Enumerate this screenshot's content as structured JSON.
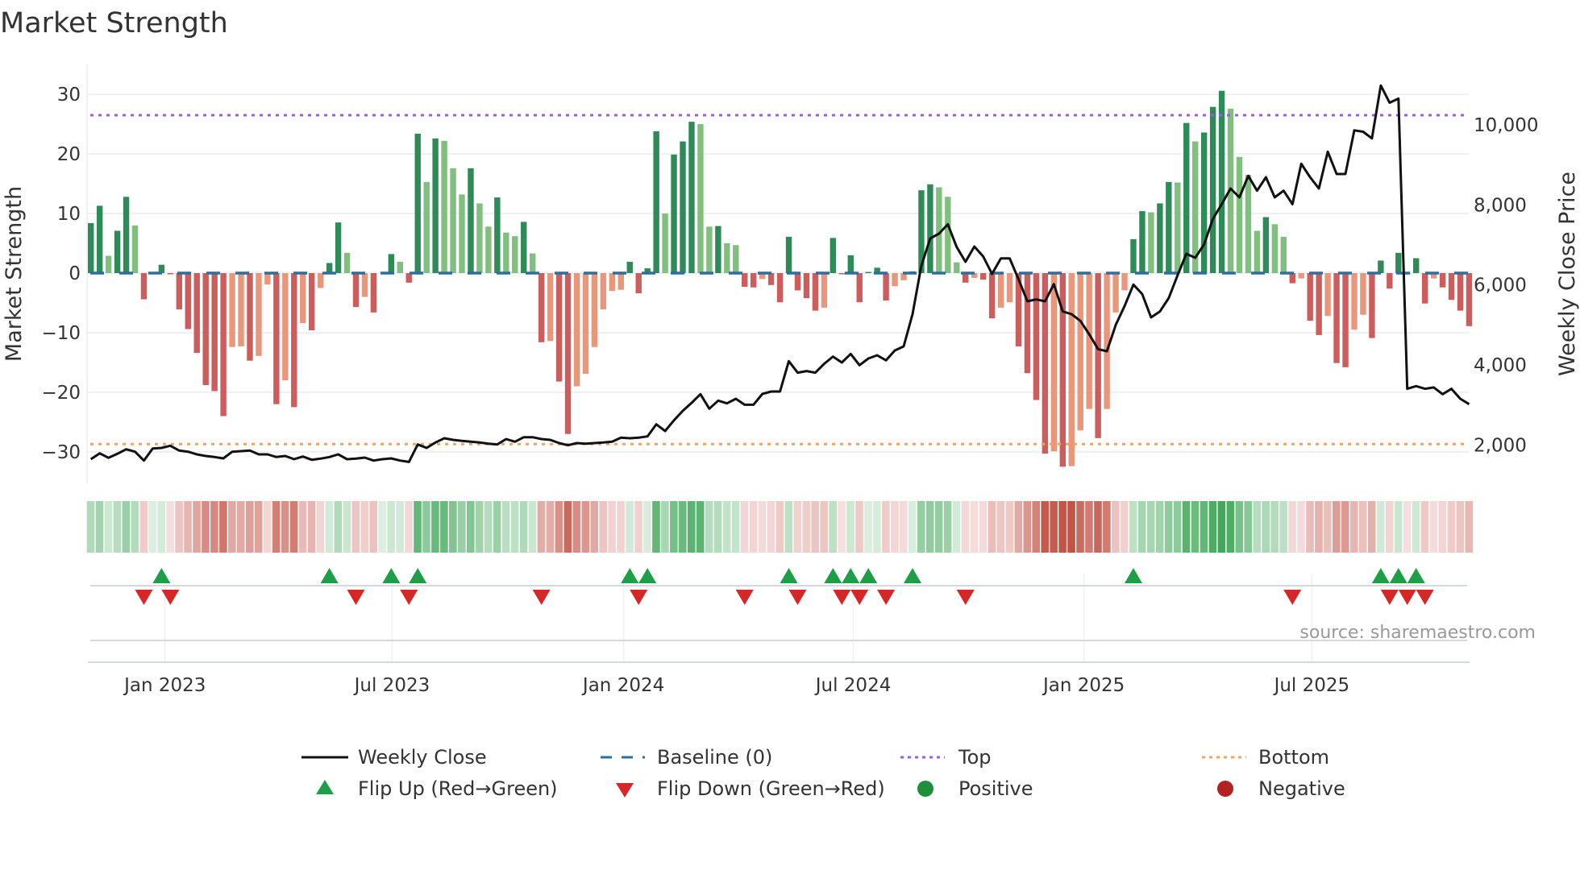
{
  "chart_data": {
    "type": "bar",
    "title": "Market Strength",
    "ylabel": "Market Strength",
    "y2label": "Weekly Close Price",
    "ylim": [
      -35,
      35
    ],
    "y2lim": [
      1000,
      11500
    ],
    "grid": true,
    "yticks": [
      "30",
      "20",
      "10",
      "0",
      "−10",
      "−20",
      "−30"
    ],
    "ytick_values": [
      30,
      20,
      10,
      0,
      -10,
      -20,
      -30
    ],
    "y2ticks": [
      "2,000",
      "4,000",
      "6,000",
      "8,000",
      "10,000"
    ],
    "y2tick_values": [
      2000,
      4000,
      6000,
      8000,
      10000
    ],
    "xticks": [
      "Jan 2023",
      "Jul 2023",
      "Jan 2024",
      "Jul 2024",
      "Jan 2025",
      "Jul 2025"
    ],
    "top_level": 26.5,
    "bottom_level": -28.7,
    "strength": [
      8.4,
      11.3,
      2.9,
      7.1,
      12.8,
      8.0,
      -4.4,
      0,
      1.4,
      -0.2,
      -6.1,
      -9.4,
      -13.4,
      -18.8,
      -19.8,
      -24.0,
      -12.4,
      -12.3,
      -14.7,
      -13.9,
      -1.9,
      -22.0,
      -18.0,
      -22.5,
      -8.4,
      -9.6,
      -2.5,
      1.7,
      8.5,
      3.4,
      -5.7,
      -4.0,
      -6.6,
      0,
      3.2,
      1.9,
      -1.6,
      23.4,
      15.3,
      22.6,
      22.2,
      17.6,
      13.2,
      17.6,
      11.7,
      7.8,
      12.7,
      6.8,
      6.2,
      8.6,
      3.3,
      -11.6,
      -11.4,
      -18.2,
      -27.0,
      -19.0,
      -16.9,
      -12.4,
      -6.1,
      -3.0,
      -2.8,
      1.9,
      -3.4,
      0.8,
      23.8,
      10.0,
      19.9,
      22.1,
      25.4,
      25.0,
      7.8,
      7.9,
      5.0,
      4.7,
      -2.3,
      -2.4,
      -1.0,
      -2.0,
      -4.9,
      6.1,
      -2.9,
      -4.2,
      -6.3,
      -5.8,
      5.9,
      -0.1,
      3.0,
      -4.9,
      0.2,
      0.9,
      -4.6,
      -2.2,
      -1.2,
      0.3,
      13.9,
      14.9,
      14.4,
      12.8,
      1.8,
      -1.6,
      -0.8,
      -1.1,
      -7.6,
      -5.8,
      -4.9,
      -12.3,
      -16.8,
      -21.3,
      -30.3,
      -29.9,
      -32.5,
      -32.4,
      -26.4,
      -22.8,
      -27.7,
      -22.8,
      -6.6,
      -2.9,
      5.7,
      10.4,
      10.2,
      11.7,
      15.3,
      15.2,
      25.2,
      22.1,
      23.6,
      27.9,
      30.6,
      27.6,
      19.5,
      16.5,
      7.1,
      9.4,
      8.2,
      6.1,
      -1.7,
      -0.9,
      -8.0,
      -10.4,
      -7.2,
      -15.1,
      -15.8,
      -9.5,
      -7.0,
      -10.9,
      2.1,
      -2.6,
      3.4,
      -0.2,
      2.5,
      -5.1,
      -0.9,
      -2.4,
      -4.5,
      -6.3,
      -8.9
    ],
    "weekly_close": [
      1648,
      1795,
      1682,
      1782,
      1896,
      1835,
      1614,
      1916,
      1930,
      1984,
      1863,
      1835,
      1769,
      1728,
      1702,
      1668,
      1835,
      1849,
      1863,
      1769,
      1769,
      1702,
      1728,
      1648,
      1715,
      1634,
      1661,
      1702,
      1769,
      1648,
      1661,
      1688,
      1614,
      1648,
      1668,
      1614,
      1580,
      2017,
      1930,
      2064,
      2171,
      2131,
      2104,
      2084,
      2064,
      2037,
      2017,
      2151,
      2084,
      2198,
      2198,
      2151,
      2131,
      2050,
      1996,
      2050,
      2037,
      2050,
      2064,
      2084,
      2185,
      2171,
      2185,
      2218,
      2519,
      2352,
      2620,
      2855,
      3056,
      3271,
      2909,
      3111,
      3042,
      3157,
      3009,
      3009,
      3278,
      3338,
      3338,
      4097,
      3809,
      3850,
      3809,
      4030,
      4211,
      4063,
      4278,
      3996,
      4163,
      4244,
      4117,
      4365,
      4465,
      5270,
      6477,
      7161,
      7282,
      7517,
      6946,
      6578,
      6960,
      6712,
      6276,
      6665,
      6665,
      6142,
      5592,
      5638,
      5592,
      6021,
      5338,
      5270,
      5103,
      4767,
      4398,
      4344,
      5002,
      5471,
      6008,
      5773,
      5190,
      5338,
      5672,
      6243,
      6780,
      6679,
      7015,
      7651,
      8020,
      8409,
      8188,
      8725,
      8355,
      8692,
      8188,
      8355,
      8020,
      9027,
      8692,
      8409,
      9329,
      8772,
      8772,
      9862,
      9829,
      9661,
      10984,
      10554,
      10655,
      3406,
      3473,
      3406,
      3440,
      3272,
      3406,
      3157,
      3022
    ],
    "legend": {
      "placement": "bottom",
      "items": [
        {
          "label": "Weekly Close",
          "symbol": "line"
        },
        {
          "label": "Baseline (0)",
          "symbol": "dashed"
        },
        {
          "label": "Top",
          "symbol": "dotted"
        },
        {
          "label": "Bottom",
          "symbol": "dotted"
        },
        {
          "label": "Flip Up (Red→Green)",
          "symbol": "triangle-up"
        },
        {
          "label": "Flip Down (Green→Red)",
          "symbol": "triangle-down"
        },
        {
          "label": "Positive",
          "symbol": "circle"
        },
        {
          "label": "Negative",
          "symbol": "circle"
        }
      ]
    },
    "source": "source: sharemaestro.com"
  },
  "colors": {
    "pos_rising": "#2e8b57",
    "pos_falling": "#80bf7d",
    "neg_falling": "#cd5c5c",
    "neg_rising": "#e9967a",
    "price_line": "#111111",
    "baseline": "#2a6f9e",
    "top": "#9b5de5",
    "bottom": "#f4a460",
    "flip_up": "#1e9e48",
    "flip_down": "#d62728",
    "positive": "#1e8f3a",
    "negative": "#b22222"
  }
}
